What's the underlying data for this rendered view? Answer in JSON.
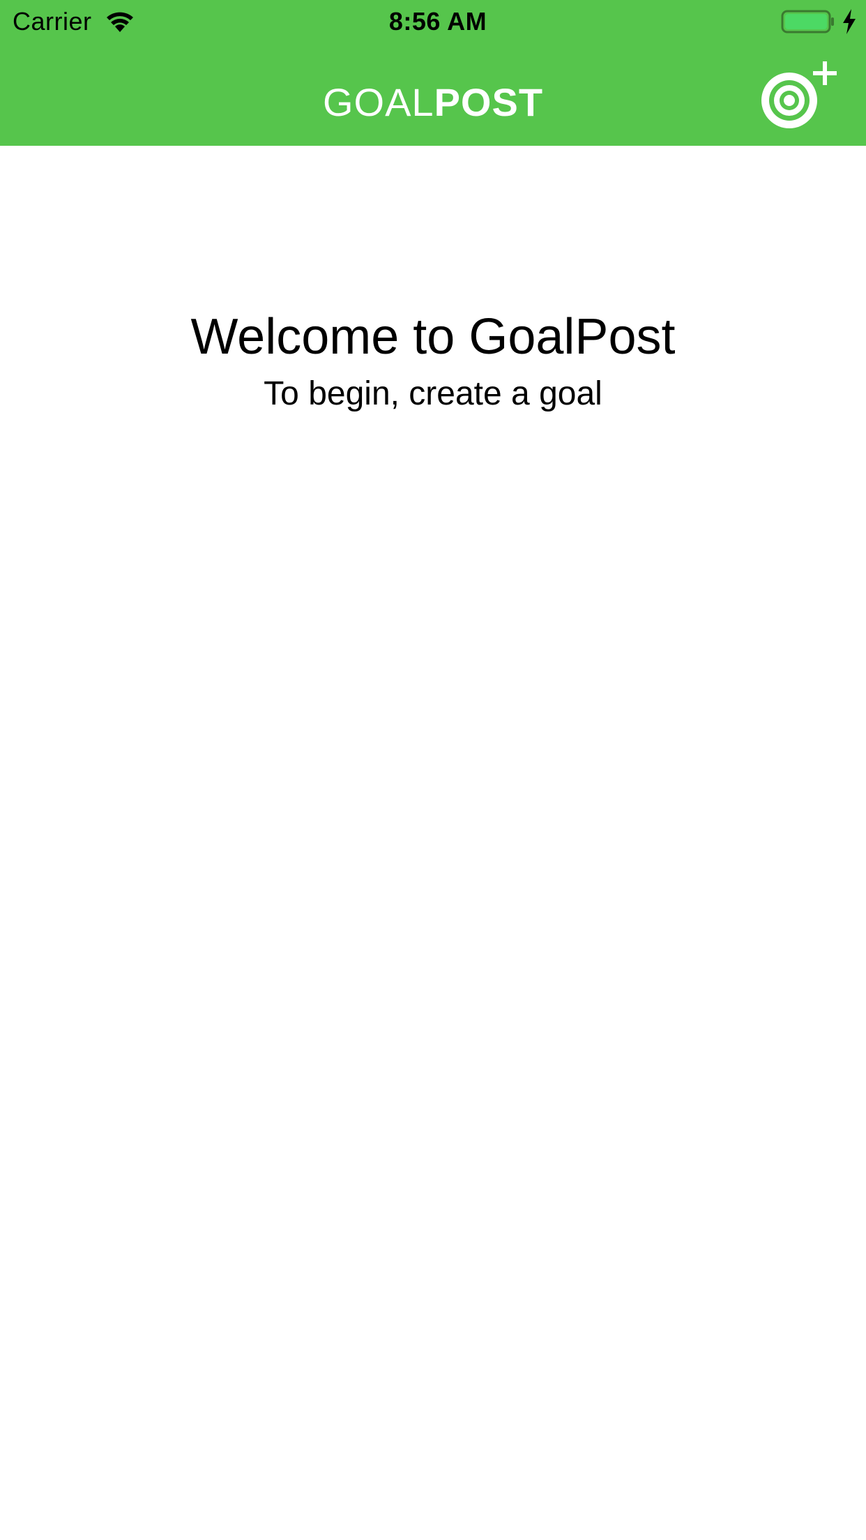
{
  "status_bar": {
    "carrier": "Carrier",
    "time": "8:56 AM"
  },
  "header": {
    "title_light": "GOAL",
    "title_bold": "POST",
    "background_color": "#56c54c",
    "add_button_icon": "target-plus-icon"
  },
  "main": {
    "welcome_title": "Welcome to GoalPost",
    "welcome_subtitle": "To begin, create a goal"
  }
}
